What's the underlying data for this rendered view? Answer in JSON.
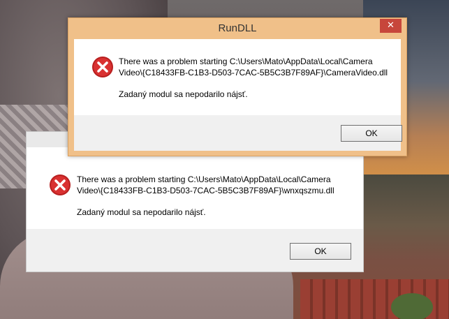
{
  "colors": {
    "front_frame": "#f0c089",
    "close_button": "#c7463b",
    "error_red": "#d72b2b",
    "content_bg": "#ffffff",
    "footer_bg": "#f0f0f0"
  },
  "front_dialog": {
    "title": "RunDLL",
    "close_label": "✕",
    "icon": "error-icon",
    "message_line1": "There was a problem starting C:\\Users\\Mato\\AppData\\Local\\Camera",
    "message_line2": "Video\\{C18433FB-C1B3-D503-7CAC-5B5C3B7F89AF}\\CameraVideo.dll",
    "detail": "Zadaný modul sa nepodarilo nájsť.",
    "ok_label": "OK"
  },
  "back_dialog": {
    "icon": "error-icon",
    "message_line1": "There was a problem starting C:\\Users\\Mato\\AppData\\Local\\Camera",
    "message_line2": "Video\\{C18433FB-C1B3-D503-7CAC-5B5C3B7F89AF}\\wnxqszmu.dll",
    "detail": "Zadaný modul sa nepodarilo nájsť.",
    "ok_label": "OK"
  }
}
